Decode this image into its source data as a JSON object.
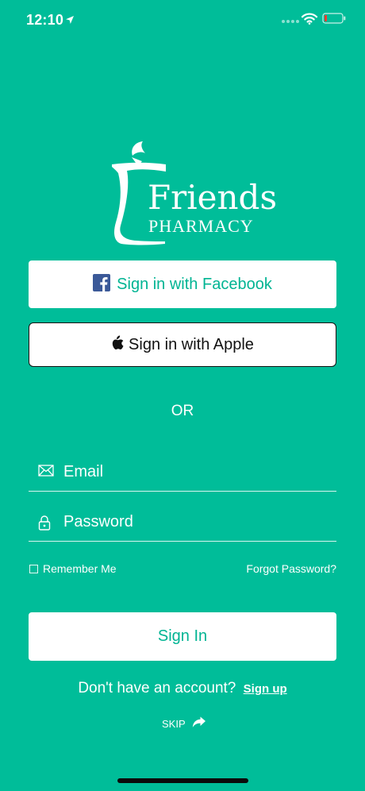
{
  "status_bar": {
    "time": "12:10",
    "icons": [
      "location-arrow-icon",
      "signal-dots-icon",
      "wifi-icon",
      "battery-low-icon"
    ],
    "battery_color": "#ff3b30"
  },
  "logo": {
    "brand": "Friends",
    "subtitle": "PHARMACY",
    "icon": "mortar-pestle-icon"
  },
  "social": {
    "facebook_label": "Sign in with Facebook",
    "facebook_icon": "facebook-icon",
    "facebook_color": "#3b5998",
    "apple_label": "Sign in with Apple",
    "apple_icon": "apple-icon"
  },
  "divider_text": "OR",
  "form": {
    "email_placeholder": "Email",
    "email_icon": "envelope-icon",
    "password_placeholder": "Password",
    "password_icon": "lock-icon",
    "remember_label": "Remember Me",
    "remember_checked": false,
    "forgot_label": "Forgot Password?",
    "signin_label": "Sign In"
  },
  "footer": {
    "prompt": "Don't have an account?",
    "signup_label": "Sign up",
    "skip_label": "SKIP",
    "skip_icon": "share-arrow-icon"
  },
  "colors": {
    "background": "#00bd99",
    "accent_text": "#00b493",
    "white": "#ffffff"
  }
}
